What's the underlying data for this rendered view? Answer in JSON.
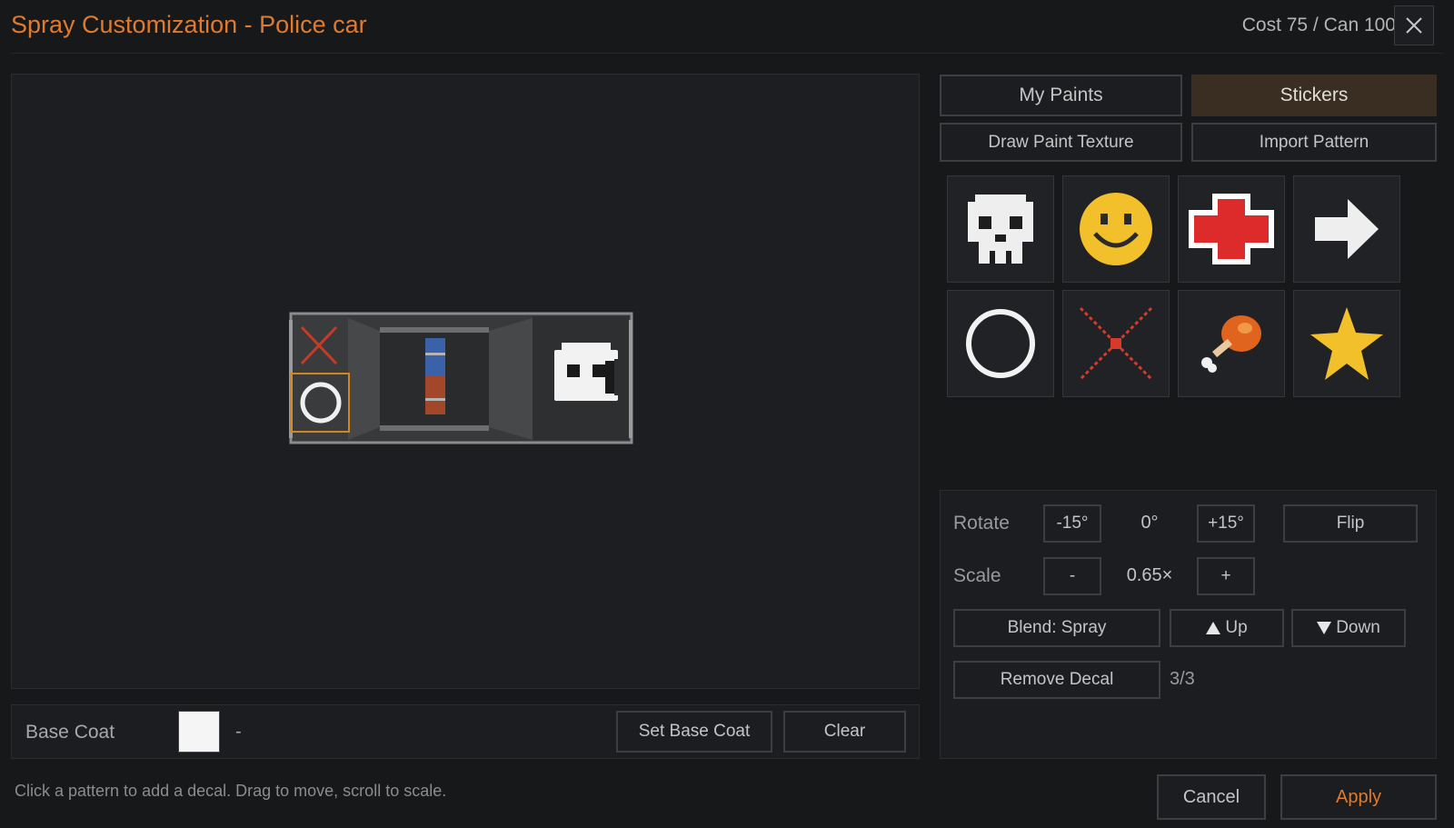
{
  "header": {
    "title": "Spray Customization - Police car",
    "cost": "Cost 75 / Can 100",
    "close_icon": "close-icon"
  },
  "tabs": [
    {
      "label": "My Paints",
      "active": false
    },
    {
      "label": "Stickers",
      "active": true
    }
  ],
  "actions": {
    "draw_paint_texture": "Draw Paint Texture",
    "import_pattern": "Import Pattern"
  },
  "stickers": [
    {
      "name": "skull",
      "icon": "skull-icon"
    },
    {
      "name": "smiley",
      "icon": "smiley-icon"
    },
    {
      "name": "red-cross",
      "icon": "red-cross-icon"
    },
    {
      "name": "arrow",
      "icon": "arrow-right-icon"
    },
    {
      "name": "circle",
      "icon": "circle-icon"
    },
    {
      "name": "x-mark",
      "icon": "x-mark-icon"
    },
    {
      "name": "drumstick",
      "icon": "drumstick-icon"
    },
    {
      "name": "star",
      "icon": "star-icon"
    }
  ],
  "controls": {
    "rotate_label": "Rotate",
    "rotate_minus": "-15°",
    "rotate_value": "0°",
    "rotate_plus": "+15°",
    "flip": "Flip",
    "scale_label": "Scale",
    "scale_minus": "-",
    "scale_value": "0.65×",
    "scale_plus": "+",
    "blend": "Blend: Spray",
    "up": "Up",
    "down": "Down",
    "remove_decal": "Remove Decal",
    "decal_count": "3/3"
  },
  "base_coat": {
    "label": "Base Coat",
    "color": "#f5f5f5",
    "value": "-",
    "set_button": "Set Base Coat",
    "clear_button": "Clear"
  },
  "footer": {
    "hint": "Click a pattern to add a decal. Drag to move, scroll to scale.",
    "cancel": "Cancel",
    "apply": "Apply"
  },
  "colors": {
    "accent": "#e07a2e",
    "selection": "#d4861e",
    "active_tab": "#3a2e22"
  }
}
